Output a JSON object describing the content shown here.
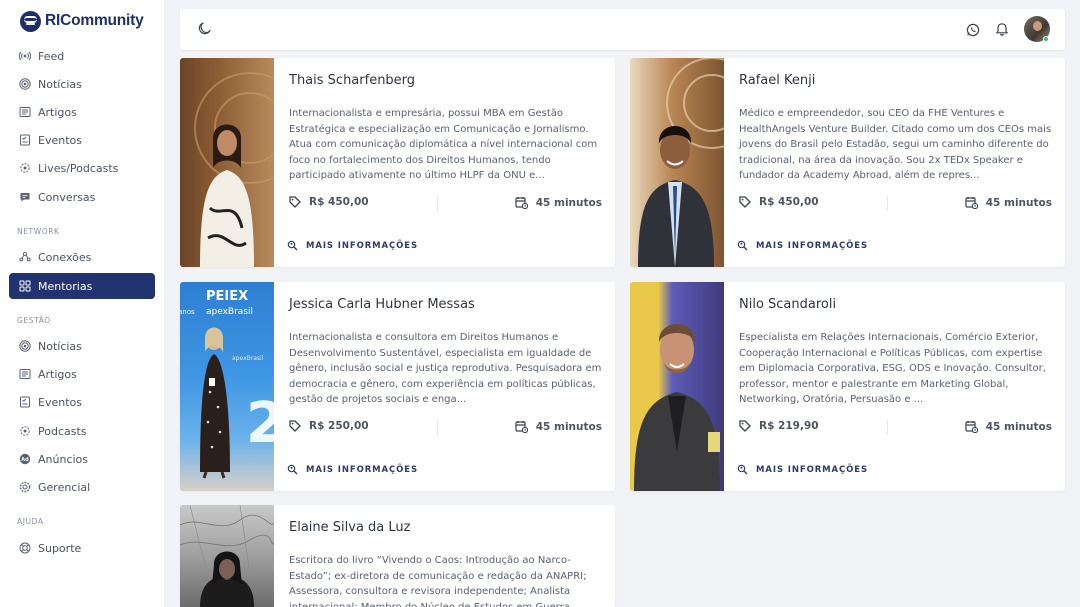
{
  "app": {
    "logo_text": "RICommunity"
  },
  "sidebar": {
    "main_items": [
      {
        "label": "Feed",
        "icon": "radio-icon"
      },
      {
        "label": "Notícias",
        "icon": "broadcast-icon"
      },
      {
        "label": "Artigos",
        "icon": "article-icon"
      },
      {
        "label": "Eventos",
        "icon": "event-icon"
      },
      {
        "label": "Lives/Podcasts",
        "icon": "podcast-icon"
      },
      {
        "label": "Conversas",
        "icon": "chat-icon"
      }
    ],
    "network_label": "NETWORK",
    "network_items": [
      {
        "label": "Conexões",
        "icon": "connections-icon"
      },
      {
        "label": "Mentorias",
        "icon": "grid-icon",
        "active": true
      }
    ],
    "gestao_label": "GESTÃO",
    "gestao_items": [
      {
        "label": "Notícias",
        "icon": "broadcast-icon"
      },
      {
        "label": "Artigos",
        "icon": "article-icon"
      },
      {
        "label": "Eventos",
        "icon": "event-icon"
      },
      {
        "label": "Podcasts",
        "icon": "podcast-icon"
      },
      {
        "label": "Anúncios",
        "icon": "ads-icon"
      },
      {
        "label": "Gerencial",
        "icon": "gear-icon"
      }
    ],
    "ajuda_label": "AJUDA",
    "ajuda_items": [
      {
        "label": "Suporte",
        "icon": "support-icon"
      }
    ]
  },
  "topbar": {
    "icons": [
      "moon-icon",
      "whatsapp-icon",
      "bell-icon",
      "user-avatar"
    ]
  },
  "mentors": [
    {
      "name": "Thais Scharfenberg",
      "description": "Internacionalista e empresária, possui MBA em Gestão Estratégica e especialização em Comunicação e Jornalismo. Atua com comunicação diplomática a nível internacional com foco no fortalecimento dos Direitos Humanos, tendo participado ativamente no último HLPF da ONU e...",
      "price": "R$ 450,00",
      "duration": "45 minutos",
      "more_label": "MAIS INFORMAÇÕES"
    },
    {
      "name": "Rafael Kenji",
      "description": "Médico e empreendedor, sou CEO da FHE Ventures e HealthAngels Venture Builder. Citado como um dos CEOs mais jovens do Brasil pelo Estadão, segui um caminho diferente do tradicional, na área da inovação. Sou 2x TEDx Speaker e fundador da Academy Abroad, além de repres...",
      "price": "R$ 450,00",
      "duration": "45 minutos",
      "more_label": "MAIS INFORMAÇÕES"
    },
    {
      "name": "Jessica Carla Hubner Messas",
      "description": "Internacionalista e consultora em Direitos Humanos e Desenvolvimento Sustentável, especialista em igualdade de gênero, inclusão social e justiça reprodutiva. Pesquisadora em democracia e gênero, com experiência em políticas públicas, gestão de projetos sociais e enga...",
      "price": "R$ 250,00",
      "duration": "45 minutos",
      "more_label": "MAIS INFORMAÇÕES",
      "photo_text": [
        "PEIEX",
        "apexBrasil",
        "anos",
        "apexBrasil",
        "2"
      ]
    },
    {
      "name": "Nilo Scandaroli",
      "description": "Especialista em Relações Internacionais, Comércio Exterior, Cooperação Internacional e Políticas Públicas, com expertise em Diplomacia Corporativa, ESG, ODS e Inovação. Consultor, professor, mentor e palestrante em Marketing Global, Networking, Oratória, Persuasão e ...",
      "price": "R$ 219,90",
      "duration": "45 minutos",
      "more_label": "MAIS INFORMAÇÕES"
    },
    {
      "name": "Elaine Silva da Luz",
      "description": "Escritora do livro “Vivendo o Caos: Introdução ao Narco-Estado”; ex-diretora de comunicação e redação da ANAPRI; Assessora, consultora e revisora independente; Analista internacional; Membro do Núcleo de Estudos em Guerra...",
      "price": "",
      "duration": "",
      "more_label": ""
    }
  ]
}
